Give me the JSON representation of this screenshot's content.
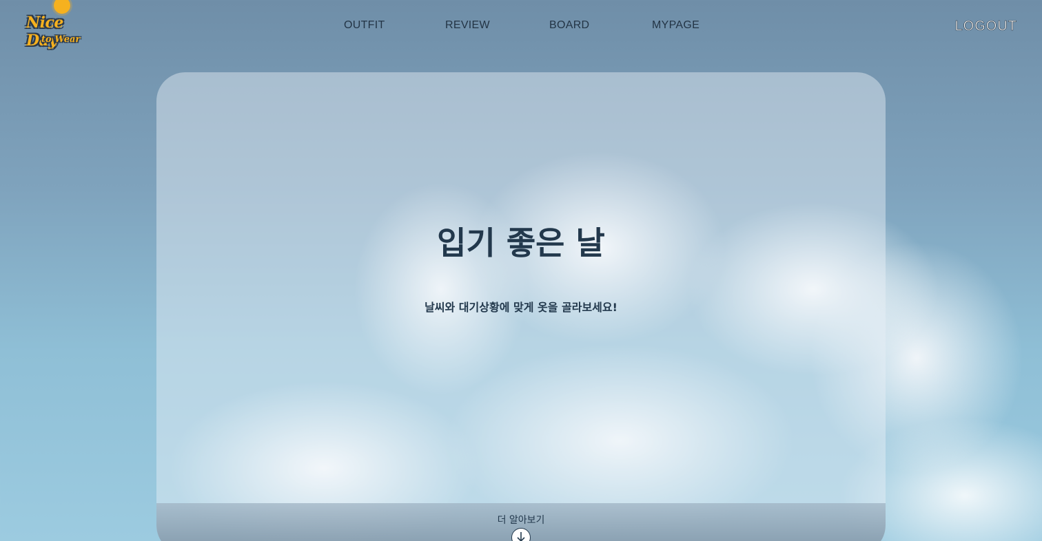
{
  "logo": {
    "line1": "Nice Day",
    "line2": "to Wear"
  },
  "nav": {
    "items": [
      {
        "label": "OUTFIT"
      },
      {
        "label": "REVIEW"
      },
      {
        "label": "BOARD"
      },
      {
        "label": "MYPAGE"
      }
    ],
    "logout_label": "LOGOUT"
  },
  "hero": {
    "title": "입기 좋은 날",
    "subtitle": "날씨와 대기상황에 맞게 옷을 골라보세요!",
    "more_label": "더 알아보기",
    "more_icon": "arrow-down-icon"
  },
  "colors": {
    "brand_yellow": "#f6b11f",
    "text_dark": "#22384c",
    "logout_text": "#ffffff"
  }
}
